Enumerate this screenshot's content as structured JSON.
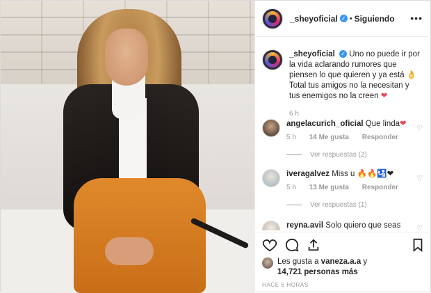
{
  "post": {
    "username": "_sheyoficial",
    "follow_separator": "•",
    "follow_label": "Siguiendo",
    "more_icon": "ellipsis-icon",
    "caption_author": "_sheyoficial",
    "caption_text": "Uno no puede ir por la vida aclarando rumores que piensen lo que quieren y ya está 👌 Total tus amigos no la necesitan y tus enemigos no la creen",
    "caption_heart": "❤",
    "caption_time": "6 h"
  },
  "comments": [
    {
      "user": "angelacurich_oficial",
      "text": "Que linda",
      "heart": "❤",
      "time": "5 h",
      "likes": "14 Me gusta",
      "reply": "Responder",
      "view_replies": "Ver respuestas (2)"
    },
    {
      "user": "iveragalvez",
      "text": "Miss u 🔥🔥🛂❤",
      "time": "5 h",
      "likes": "13 Me gusta",
      "reply": "Responder",
      "view_replies": "Ver respuestas (1)"
    },
    {
      "user": "reyna.avil",
      "text": "Solo quiero que seas"
    }
  ],
  "likes": {
    "prefix": "Les gusta a",
    "user": "vaneza.a.a",
    "conj": "y",
    "count": "14,721 personas más"
  },
  "timestamp": "HACE 6 HORAS",
  "colors": {
    "verified": "#3897f0",
    "heart": "#ed4956",
    "meta": "#999999"
  },
  "icons": {
    "like": "heart-outline-icon",
    "comment": "comment-bubble-icon",
    "share": "share-icon",
    "save": "bookmark-icon"
  }
}
